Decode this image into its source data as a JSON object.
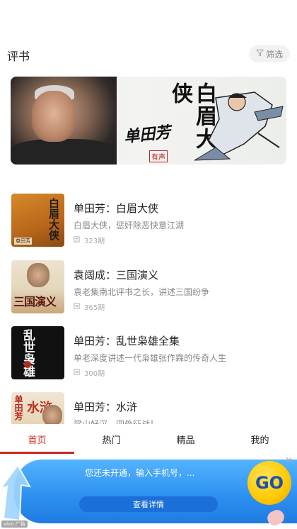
{
  "header": {
    "title": "评书",
    "filter_label": "筛选"
  },
  "banner": {
    "title": "白眉大侠",
    "signature": "单田芳",
    "seal": "有声"
  },
  "items": [
    {
      "name": "单田芳：白眉大侠",
      "desc": "白眉大侠，惩奸除恶快意江湖",
      "count": "323期",
      "cover_text": "白眉大侠",
      "cover_badge": "单田芳"
    },
    {
      "name": "袁阔成：三国演义",
      "desc": "袁老集南北评书之长，讲述三国纷争",
      "count": "365期",
      "cover_text": "三国演义"
    },
    {
      "name": "单田芳：乱世枭雄全集",
      "desc": "单老深度讲述一代枭雄张作霖的传奇人生",
      "count": "300期",
      "cover_text": "乱世枭雄"
    },
    {
      "name": "单田芳：水浒",
      "desc": "梁山好汉，四处征战！",
      "count": "",
      "cover_text1": "单田芳",
      "cover_text2": "水浒"
    }
  ],
  "tabbar": {
    "tabs": [
      "首页",
      "热门",
      "精品",
      "我的"
    ],
    "active_index": 0
  },
  "promo": {
    "message": "您还未开通，输入手机号，...",
    "cta": "查看详情",
    "go_label": "GO",
    "close": "×",
    "tag": "vivo 广告"
  },
  "colors": {
    "accent": "#d0281e",
    "promo_blue": "#2b8ff0",
    "go_yellow": "#ffc800"
  }
}
